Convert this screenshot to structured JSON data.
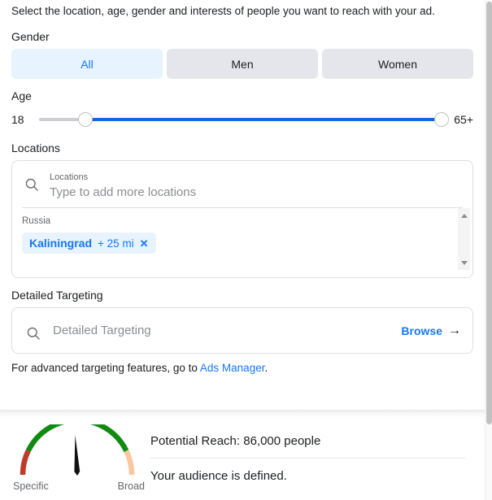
{
  "intro": "Select the location, age, gender and interests of people you want to reach with your ad.",
  "gender": {
    "label": "Gender",
    "options": [
      {
        "label": "All",
        "selected": true
      },
      {
        "label": "Men",
        "selected": false
      },
      {
        "label": "Women",
        "selected": false
      }
    ]
  },
  "age": {
    "label": "Age",
    "min_label": "18",
    "max_label": "65+",
    "min_value": 18,
    "max_value": 65
  },
  "locations": {
    "label": "Locations",
    "field_label": "Locations",
    "placeholder": "Type to add more locations",
    "search_icon": "search-icon",
    "country": "Russia",
    "chips": [
      {
        "name": "Kaliningrad",
        "radius": "+ 25 mi",
        "close_icon": "✕"
      }
    ]
  },
  "detailed_targeting": {
    "label": "Detailed Targeting",
    "placeholder": "Detailed Targeting",
    "search_icon": "search-icon",
    "browse_label": "Browse",
    "browse_arrow": "→",
    "note_prefix": "For advanced targeting features, go to ",
    "note_link": "Ads Manager",
    "note_suffix": "."
  },
  "footer": {
    "gauge": {
      "left_label": "Specific",
      "right_label": "Broad",
      "needle_angle_deg": -3,
      "colors": {
        "low": "#c0392b",
        "good": "#128a12",
        "high": "#fac7a0"
      }
    },
    "potential_reach": "Potential Reach: 86,000 people",
    "status": "Your audience is defined."
  },
  "colors": {
    "accent": "#1877f2",
    "accent_bg": "#e7f3ff",
    "neutral_bg": "#e4e6eb",
    "slider_fill": "#1565e0"
  }
}
